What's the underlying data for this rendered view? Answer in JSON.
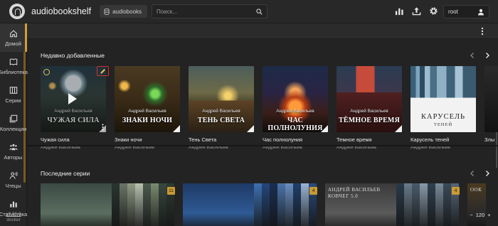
{
  "header": {
    "app_title": "audiobookshelf",
    "library": "audiobooks",
    "search_placeholder": "Поиск...",
    "user": "root",
    "icons": [
      "stats-icon",
      "upload-icon",
      "settings-gear-icon",
      "user-icon"
    ]
  },
  "sidebar": {
    "items": [
      {
        "label": "Домой",
        "icon": "home-icon",
        "active": true
      },
      {
        "label": "Библиотека",
        "icon": "library-book-icon",
        "active": false
      },
      {
        "label": "Серии",
        "icon": "series-columns-icon",
        "active": false
      },
      {
        "label": "Коллекции",
        "icon": "collections-icon",
        "active": false
      },
      {
        "label": "Авторы",
        "icon": "authors-icon",
        "active": false
      },
      {
        "label": "Чтецы",
        "icon": "narrators-icon",
        "active": false
      },
      {
        "label": "Статистика",
        "icon": "stats-icon",
        "active": false
      }
    ],
    "version": "v2.31.0",
    "platform": "docker"
  },
  "recent": {
    "title": "Недавно добавленные",
    "books": [
      {
        "title": "Чужая сила",
        "author": "Андрей Васильев",
        "cover_author": "Андрей Васильев",
        "cover_title": "ЧУЖАЯ СИЛА",
        "theme": "moon"
      },
      {
        "title": "Знаки ночи",
        "author": "Андрей Васильев",
        "cover_author": "Андрей Васильев",
        "cover_title": "ЗНАКИ НОЧИ",
        "theme": "alchemy"
      },
      {
        "title": "Тень Света",
        "author": "Андрей Васильев",
        "cover_author": "Андрей Васильев",
        "cover_title": "ТЕНЬ СВЕТА",
        "theme": "road"
      },
      {
        "title": "Час полнолуния",
        "author": "Андрей Васильев",
        "cover_author": "Андрей Васильев",
        "cover_title": "ЧАС ПОЛНОЛУНИЯ",
        "theme": "temple"
      },
      {
        "title": "Темное время",
        "author": "Андрей Васильев",
        "cover_author": "Андрей Васильев",
        "cover_title": "ТЁМНОЕ ВРЕМЯ",
        "theme": "city"
      },
      {
        "title": "Карусель теней",
        "author": "Андрей Васильев",
        "cover_author": "",
        "cover_title": "КАРУСЕЛЬ",
        "cover_subtitle": "ТЕНЕЙ",
        "theme": "skyline"
      },
      {
        "title": "Злы",
        "author": "",
        "cover_author": "",
        "cover_title": "",
        "theme": "dark"
      }
    ]
  },
  "series": {
    "title": "Последние серии",
    "items": [
      {
        "badge": "11",
        "cover_text": ""
      },
      {
        "badge": "4",
        "cover_text": ""
      },
      {
        "badge": "4",
        "cover_text": "АНДРЕЙ ВАСИЛЬЕВ КОВЧЕГ 5.0"
      },
      {
        "badge": "",
        "cover_text": "ООК"
      }
    ]
  },
  "zoom": {
    "minus": "−",
    "value": "120",
    "plus": "+"
  },
  "colors": {
    "accent": "#d29c3a",
    "edit_highlight": "#d23232",
    "background": "#232323"
  }
}
